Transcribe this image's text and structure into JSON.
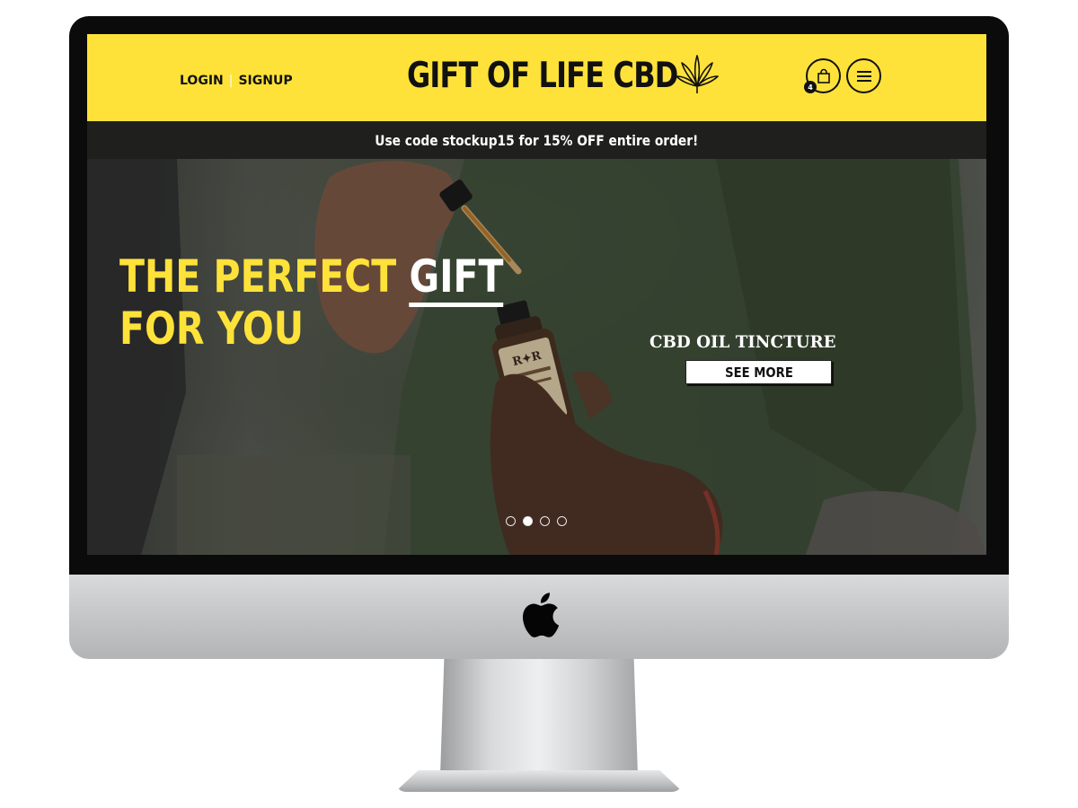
{
  "header": {
    "login_label": "LOGIN",
    "separator": "|",
    "signup_label": "SIGNUP",
    "site_title": "GIFT OF LIFE CBD",
    "cart_count": "4",
    "brand_color": "#fee23a"
  },
  "promo": {
    "text": "Use code stockup15 for 15% OFF entire order!"
  },
  "hero": {
    "headline_part1": "THE PERFECT ",
    "headline_highlight": "GIFT",
    "headline_line2": "FOR YOU",
    "product_label": "CBD OIL TINCTURE",
    "cta_label": "SEE MORE",
    "slides_total": 4,
    "active_slide": 2
  },
  "icons": [
    "cannabis-leaf-icon",
    "shopping-bag-icon",
    "hamburger-menu-icon",
    "apple-logo-icon"
  ]
}
